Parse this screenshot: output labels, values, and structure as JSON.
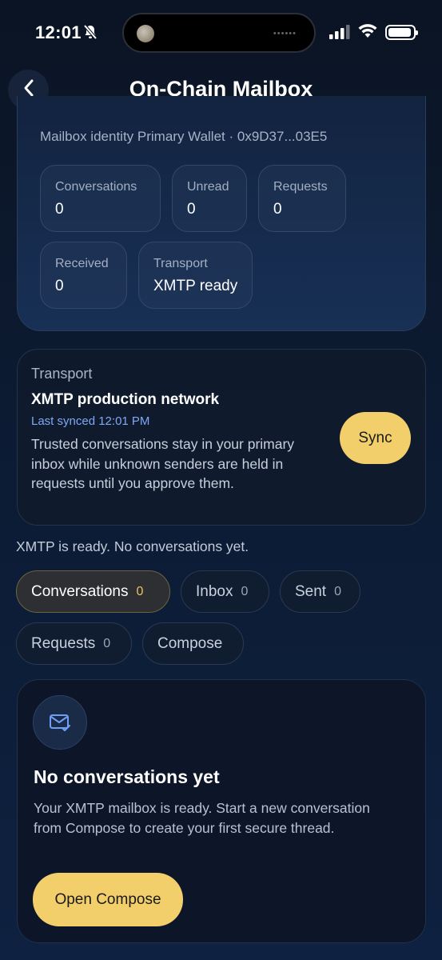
{
  "status_bar": {
    "time": "12:01"
  },
  "header": {
    "title": "On-Chain Mailbox"
  },
  "identity": {
    "label": "Mailbox identity Primary Wallet · 0x9D37...03E5",
    "stats": [
      {
        "label": "Conversations",
        "value": "0"
      },
      {
        "label": "Unread",
        "value": "0"
      },
      {
        "label": "Requests",
        "value": "0"
      },
      {
        "label": "Received",
        "value": "0"
      },
      {
        "label": "Transport",
        "value": "XMTP ready"
      }
    ]
  },
  "transport": {
    "label": "Transport",
    "network": "XMTP production network",
    "last_synced": "Last synced 12:01 PM",
    "description": "Trusted conversations stay in your primary inbox while unknown senders are held in requests until you approve them.",
    "sync_label": "Sync"
  },
  "status_message": "XMTP is ready. No conversations yet.",
  "tabs": [
    {
      "label": "Conversations",
      "count": "0",
      "active": true
    },
    {
      "label": "Inbox",
      "count": "0"
    },
    {
      "label": "Sent",
      "count": "0"
    },
    {
      "label": "Requests",
      "count": "0"
    },
    {
      "label": "Compose",
      "count": ""
    }
  ],
  "empty_state": {
    "icon": "mail-check-icon",
    "title": "No conversations yet",
    "description": "Your XMTP mailbox is ready. Start a new conversation from Compose to create your first secure thread.",
    "button_label": "Open Compose"
  },
  "colors": {
    "accent": "#f3cf6b",
    "link": "#7fa8f5",
    "background": "#0c1b33"
  }
}
